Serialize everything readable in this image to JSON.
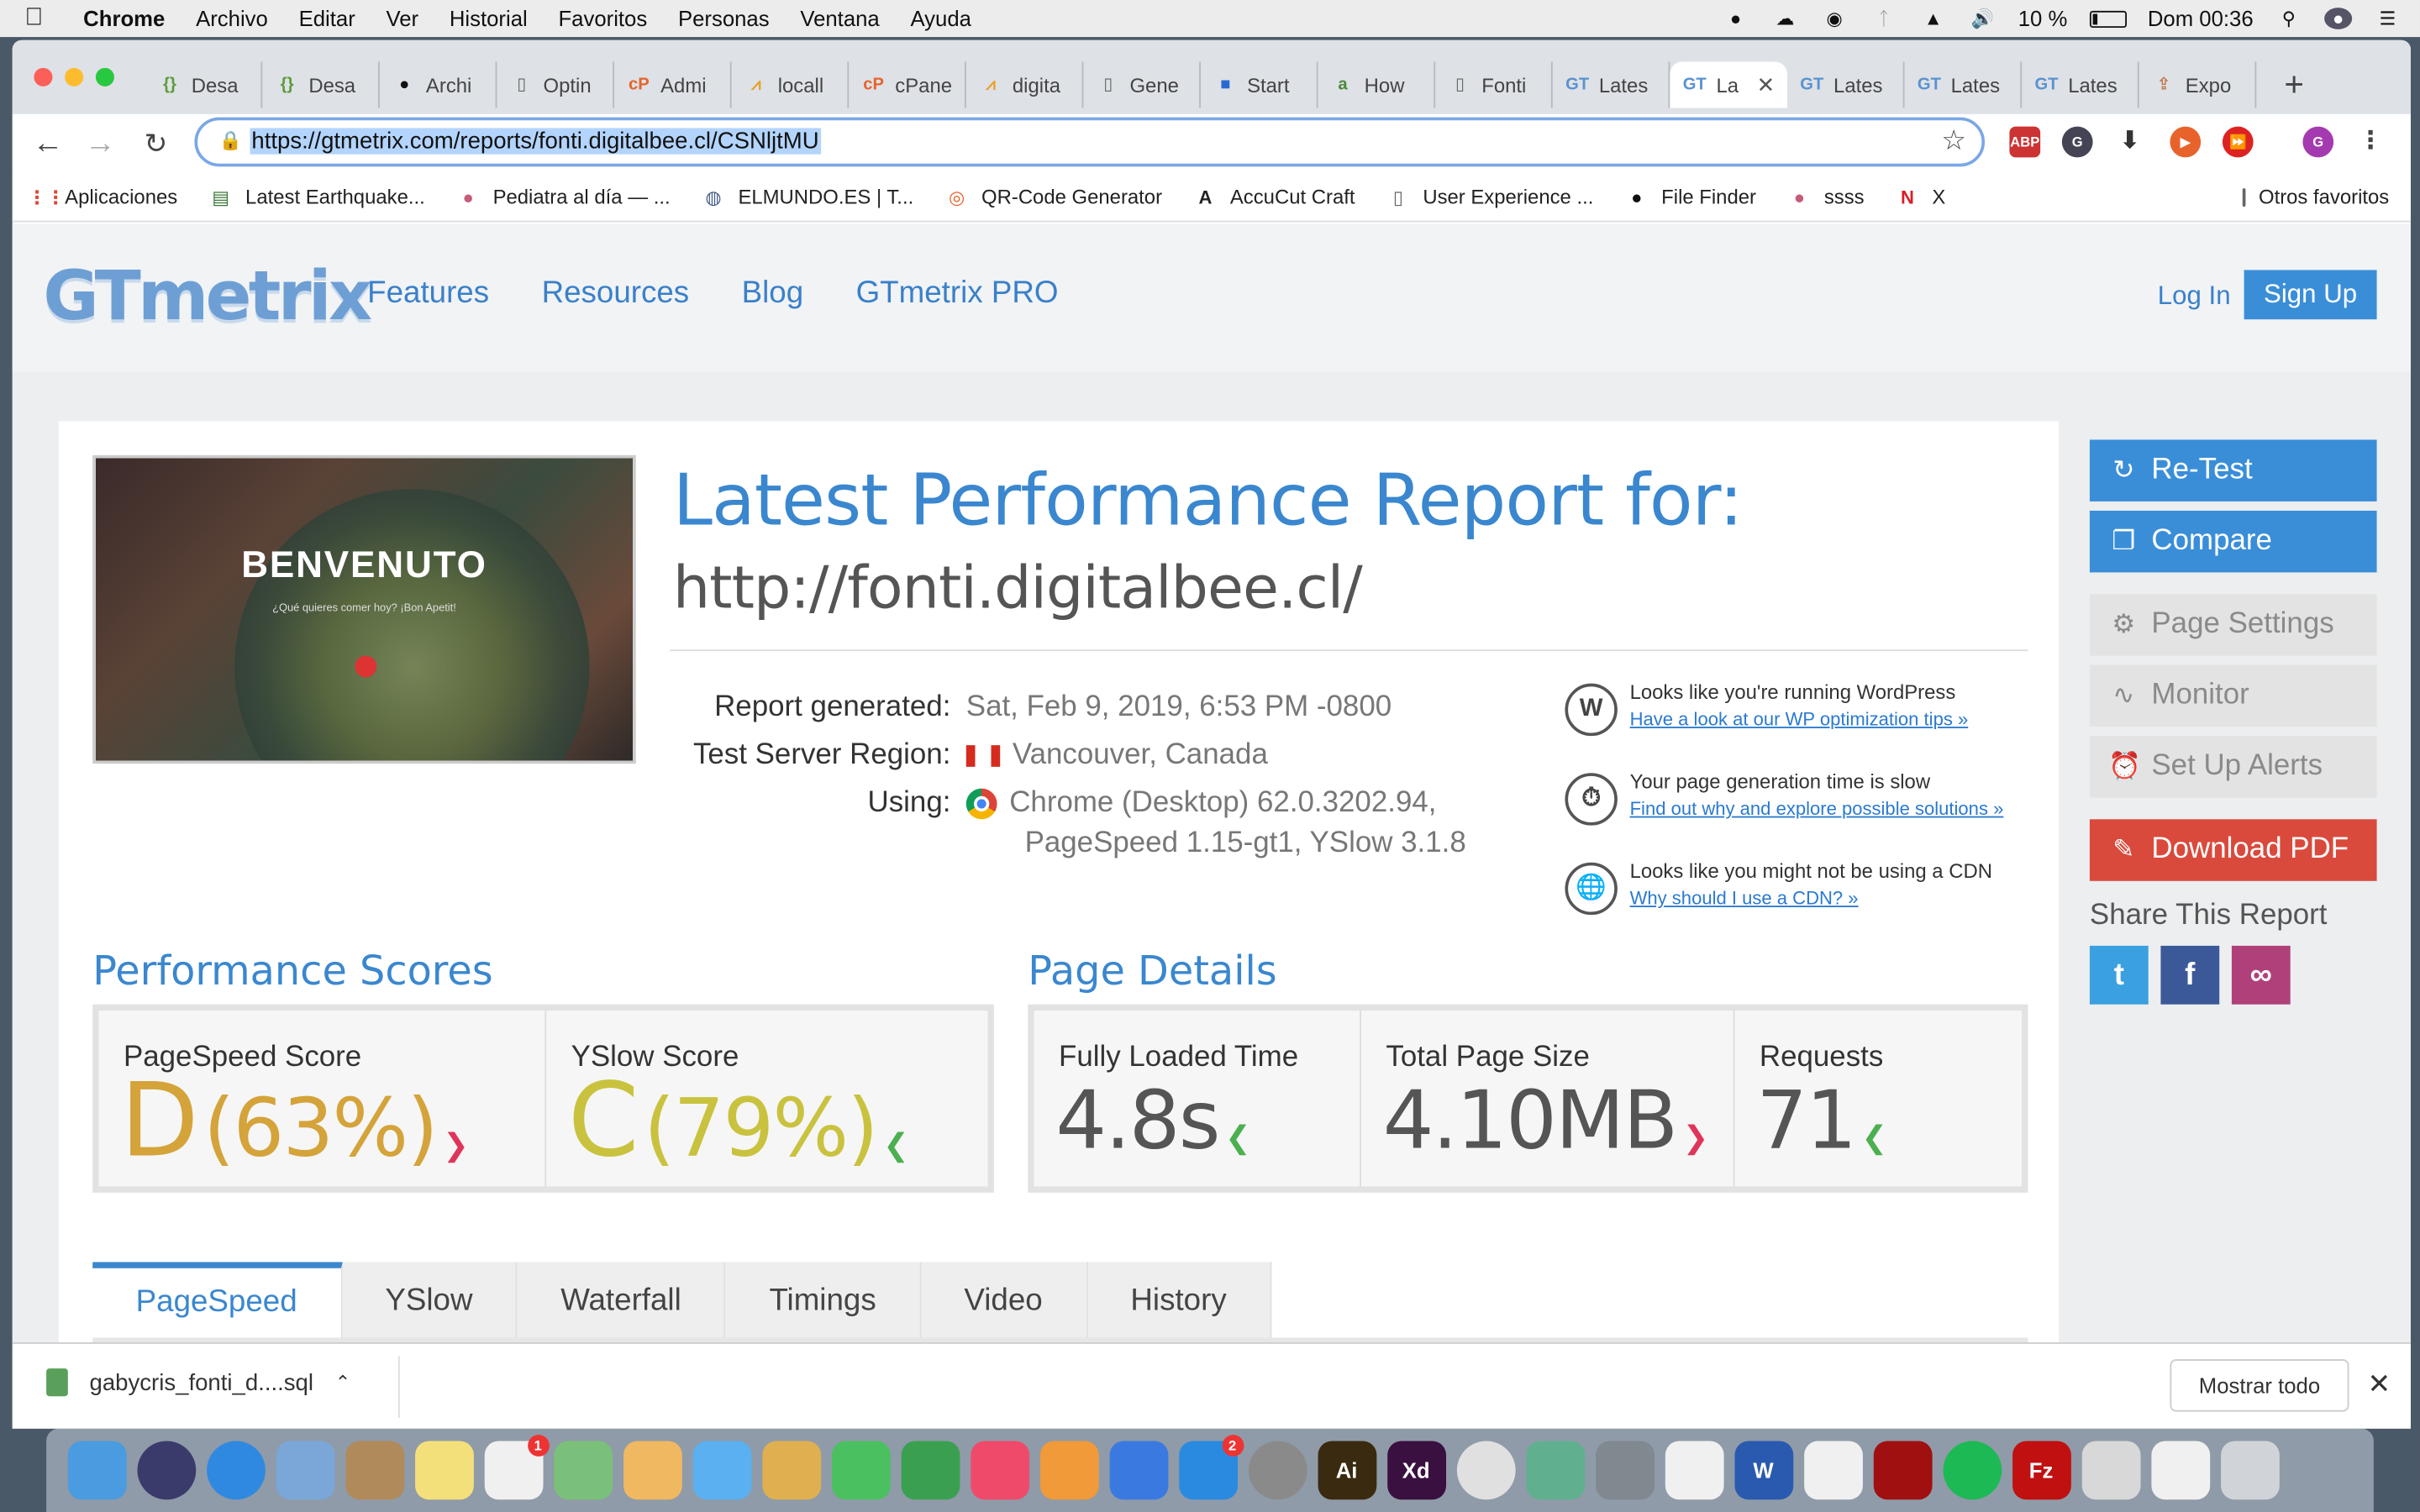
{
  "menubar": {
    "app": "Chrome",
    "items": [
      "Archivo",
      "Editar",
      "Ver",
      "Historial",
      "Favoritos",
      "Personas",
      "Ventana",
      "Ayuda"
    ],
    "battery": "10 %",
    "clock": "Dom 00:36"
  },
  "tabs": [
    {
      "label": "Desa",
      "icon": "dev-icon",
      "color": "#5b9b3a"
    },
    {
      "label": "Desa",
      "icon": "dev-icon",
      "color": "#5b9b3a"
    },
    {
      "label": "Archi",
      "icon": "github-icon",
      "color": "#111111"
    },
    {
      "label": "Optin",
      "icon": "page-icon",
      "color": "#666666"
    },
    {
      "label": "Admi",
      "icon": "cpanel-icon",
      "color": "#e8632b"
    },
    {
      "label": "locall",
      "icon": "phpmyadmin-icon",
      "color": "#e8a12b"
    },
    {
      "label": "cPane",
      "icon": "cpanel-icon",
      "color": "#e8632b"
    },
    {
      "label": "digita",
      "icon": "phpmyadmin-icon",
      "color": "#e8a12b"
    },
    {
      "label": "Gene",
      "icon": "page-icon",
      "color": "#666666"
    },
    {
      "label": "Start",
      "icon": "flag-icon",
      "color": "#2a6ad0"
    },
    {
      "label": "How",
      "icon": "how-icon",
      "color": "#4a8a3a"
    },
    {
      "label": "Fonti",
      "icon": "page-icon",
      "color": "#666666"
    },
    {
      "label": "Lates",
      "icon": "gt-icon",
      "color": "#5a93d0"
    },
    {
      "label": "La",
      "icon": "gt-icon",
      "color": "#5a93d0",
      "active": true
    },
    {
      "label": "Lates",
      "icon": "gt-icon",
      "color": "#5a93d0"
    },
    {
      "label": "Lates",
      "icon": "gt-icon",
      "color": "#5a93d0"
    },
    {
      "label": "Lates",
      "icon": "gt-icon",
      "color": "#5a93d0"
    },
    {
      "label": "Expo",
      "icon": "export-icon",
      "color": "#c07040"
    }
  ],
  "omnibox": {
    "url": "https://gtmetrix.com/reports/fonti.digitalbee.cl/CSNljtMU"
  },
  "bookmarks": [
    {
      "label": "Aplicaciones",
      "icon": "apps-icon"
    },
    {
      "label": "Latest Earthquake...",
      "icon": "earthquake-icon"
    },
    {
      "label": "Pediatra al día — ...",
      "icon": "pediatra-icon"
    },
    {
      "label": "ELMUNDO.ES | T...",
      "icon": "globe-icon"
    },
    {
      "label": "QR-Code Generator",
      "icon": "qr-icon"
    },
    {
      "label": "AccuCut Craft",
      "icon": "accucut-icon"
    },
    {
      "label": "User Experience ...",
      "icon": "page-icon"
    },
    {
      "label": "File Finder",
      "icon": "github-icon"
    },
    {
      "label": "ssss",
      "icon": "pediatra-icon"
    },
    {
      "label": "X",
      "icon": "netflix-icon"
    }
  ],
  "bookmarks_other": "Otros favoritos",
  "gt": {
    "logo": "GTmetrix",
    "nav": [
      "Features",
      "Resources",
      "Blog",
      "GTmetrix PRO"
    ],
    "login": "Log In",
    "signup": "Sign Up",
    "thumb_title": "BENVENUTO",
    "thumb_sub": "¿Qué quieres comer hoy? ¡Bon Apetit!",
    "title": "Latest Performance Report for:",
    "url": "http://fonti.digitalbee.cl/",
    "report_generated_label": "Report generated:",
    "report_generated": "Sat, Feb 9, 2019, 6:53 PM -0800",
    "region_label": "Test Server Region:",
    "region": "Vancouver, Canada",
    "using_label": "Using:",
    "using_1": "Chrome (Desktop) 62.0.3202.94,",
    "using_2": "PageSpeed 1.15-gt1, YSlow 3.1.8",
    "tips": [
      {
        "text": "Looks like you're running WordPress",
        "link": "Have a look at our WP optimization tips »",
        "icon": "wordpress-icon"
      },
      {
        "text": "Your page generation time is slow",
        "link": "Find out why and explore possible solutions »",
        "icon": "stopwatch-icon"
      },
      {
        "text": "Looks like you might not be using a CDN",
        "link": "Why should I use a CDN? »",
        "icon": "globe-icon"
      }
    ],
    "perf_title": "Performance Scores",
    "pagespeed_label": "PageSpeed Score",
    "pagespeed_grade": "D",
    "pagespeed_pct": "(63%)",
    "yslow_label": "YSlow Score",
    "yslow_grade": "C",
    "yslow_pct": "(79%)",
    "details_title": "Page Details",
    "loaded_label": "Fully Loaded Time",
    "loaded": "4.8s",
    "size_label": "Total Page Size",
    "size": "4.10MB",
    "req_label": "Requests",
    "requests": "71",
    "report_tabs": [
      "PageSpeed",
      "YSlow",
      "Waterfall",
      "Timings",
      "Video",
      "History"
    ],
    "sidebar": [
      {
        "label": "Re-Test",
        "style": "blue",
        "icon": "refresh-icon"
      },
      {
        "label": "Compare",
        "style": "blue",
        "icon": "compare-icon"
      },
      {
        "label": "Page Settings",
        "style": "grey",
        "icon": "gear-icon"
      },
      {
        "label": "Monitor",
        "style": "grey",
        "icon": "pulse-icon"
      },
      {
        "label": "Set Up Alerts",
        "style": "grey",
        "icon": "alarm-icon"
      },
      {
        "label": "Download PDF",
        "style": "red",
        "icon": "pdf-icon"
      }
    ],
    "share_title": "Share This Report",
    "colors": {
      "grade_d": "#d4a33a",
      "grade_c": "#c9c23e",
      "blue": "#3a87cf"
    }
  },
  "download": {
    "file": "gabycris_fonti_d....sql",
    "show_all": "Mostrar todo"
  },
  "dock": [
    {
      "name": "finder-icon",
      "color": "#4a9be0"
    },
    {
      "name": "siri-icon",
      "color": "#3b3b6b"
    },
    {
      "name": "safari-icon",
      "color": "#2f89e0"
    },
    {
      "name": "mail-icon",
      "color": "#7aa7d8"
    },
    {
      "name": "contacts-icon",
      "color": "#b08a5a"
    },
    {
      "name": "notes-icon",
      "color": "#f4e07a"
    },
    {
      "name": "reminders-icon",
      "color": "#f0f0f0",
      "badge": "1"
    },
    {
      "name": "maps-icon",
      "color": "#7ac07a"
    },
    {
      "name": "photos-icon",
      "color": "#f0b860"
    },
    {
      "name": "messages-icon",
      "color": "#5ab0f0"
    },
    {
      "name": "keynote-draw-icon",
      "color": "#e0b050"
    },
    {
      "name": "facetime-icon",
      "color": "#4ac060"
    },
    {
      "name": "numbers-icon",
      "color": "#3aa050"
    },
    {
      "name": "music-icon",
      "color": "#f04a6a"
    },
    {
      "name": "books-icon",
      "color": "#f09a3a"
    },
    {
      "name": "keynote-icon",
      "color": "#3a7ae0"
    },
    {
      "name": "app-store-icon",
      "color": "#2a8ae0",
      "badge": "2"
    },
    {
      "name": "system-preferences-icon",
      "color": "#8a8a8a"
    },
    {
      "name": "illustrator-icon",
      "color": "#3a2a10",
      "text": "Ai"
    },
    {
      "name": "xd-icon",
      "color": "#3a1040",
      "text": "Xd"
    },
    {
      "name": "chrome-icon",
      "color": "#e0e0e0"
    },
    {
      "name": "atom-icon",
      "color": "#60b090"
    },
    {
      "name": "sequel-pro-icon",
      "color": "#808890"
    },
    {
      "name": "textedit-icon",
      "color": "#f0f0f0"
    },
    {
      "name": "word-icon",
      "color": "#2a5ab0",
      "text": "W"
    },
    {
      "name": "preview-icon",
      "color": "#f0f0f0"
    },
    {
      "name": "acrobat-icon",
      "color": "#a01010"
    },
    {
      "name": "spotify-icon",
      "color": "#1db954"
    },
    {
      "name": "filezilla-icon",
      "color": "#c01010",
      "text": "Fz"
    },
    {
      "name": "downloads-stack-icon",
      "color": "#d8d8d8"
    },
    {
      "name": "documents-stack-icon",
      "color": "#f0f0f0"
    },
    {
      "name": "trash-icon",
      "color": "#d0d4d8"
    }
  ]
}
